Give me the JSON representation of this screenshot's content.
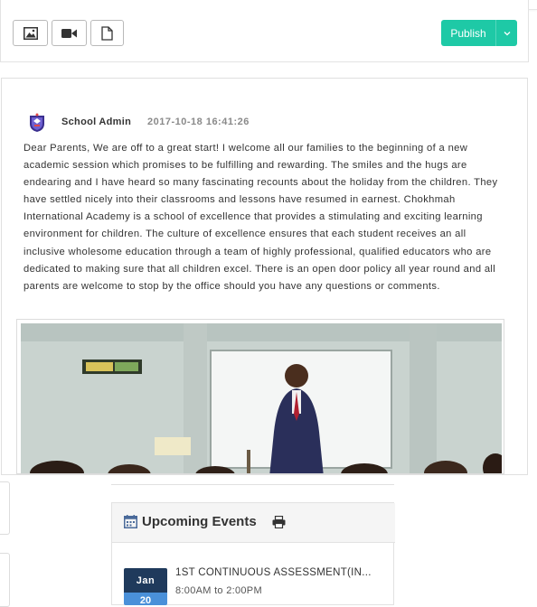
{
  "composer": {
    "attach_buttons": [
      "image-icon",
      "video-icon",
      "file-icon"
    ],
    "publish_label": "Publish",
    "accent": "#1ec9a6"
  },
  "post": {
    "author": "School Admin",
    "timestamp": "2017-10-18 16:41:26",
    "body": "Dear Parents, We are off to a great start! I welcome all our families to the beginning of a new academic session which promises to be fulfilling and rewarding. The smiles and the hugs are endearing and I have heard so many fascinating recounts about the holiday from the children. They have settled nicely into their classrooms and lessons have resumed in earnest. Chokhmah International Academy is a school of excellence that provides a stimulating and exciting learning environment for children. The culture of excellence ensures that each student receives an all inclusive wholesome education through a team of highly professional, qualified educators who are dedicated to making sure that all children excel. There is an open door policy all year round and all parents are welcome to stop by the office should you have any questions or comments."
  },
  "events": {
    "title": "Upcoming Events",
    "items": [
      {
        "month": "Jan",
        "day": "20",
        "title": "1ST CONTINUOUS ASSESSMENT(IN...",
        "time": "8:00AM to 2:00PM"
      }
    ]
  }
}
